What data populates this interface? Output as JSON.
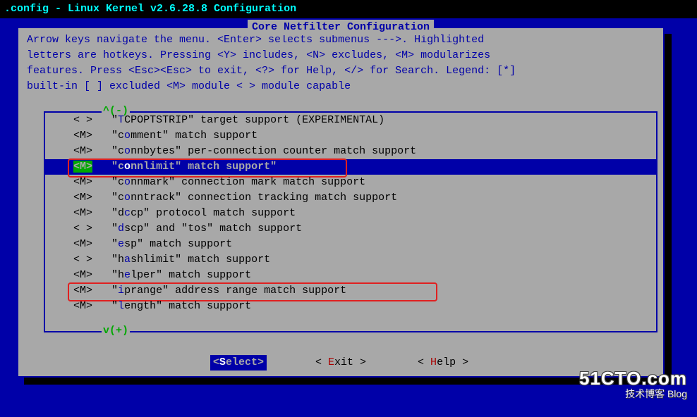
{
  "title_bar": ".config - Linux Kernel v2.6.28.8 Configuration",
  "dialog_title": " Core Netfilter Configuration ",
  "help": {
    "l1": "Arrow keys navigate the menu.  <Enter> selects submenus --->.  Highlighted",
    "l2": "letters are hotkeys.  Pressing <Y> includes, <N> excludes, <M> modularizes",
    "l3": "features.  Press <Esc><Esc> to exit, <?> for Help, </> for Search.  Legend: [*]",
    "l4": "built-in  [ ] excluded  <M> module  < > module capable"
  },
  "scroll_up": "^(-)",
  "scroll_down": "v(+)",
  "items": [
    {
      "sel": "< >",
      "pre": "\"",
      "hot": "T",
      "rest": "CPOPTSTRIP\" target support (EXPERIMENTAL)"
    },
    {
      "sel": "<M>",
      "pre": "\"c",
      "hot": "o",
      "rest": "mment\" match support"
    },
    {
      "sel": "<M>",
      "pre": "\"c",
      "hot": "o",
      "rest": "nnbytes\" per-connection counter match support"
    },
    {
      "sel": "<M>",
      "pre": "\"c",
      "hot": "o",
      "rest": "nnlimit\" match support\""
    },
    {
      "sel": "<M>",
      "pre": "\"c",
      "hot": "o",
      "rest": "nnmark\" connection mark match support"
    },
    {
      "sel": "<M>",
      "pre": "\"c",
      "hot": "o",
      "rest": "nntrack\" connection tracking match support"
    },
    {
      "sel": "<M>",
      "pre": "\"d",
      "hot": "c",
      "rest": "cp\" protocol match support"
    },
    {
      "sel": "< >",
      "pre": "\"",
      "hot": "d",
      "rest": "scp\" and \"tos\" match support"
    },
    {
      "sel": "<M>",
      "pre": "\"",
      "hot": "e",
      "rest": "sp\" match support"
    },
    {
      "sel": "< >",
      "pre": "\"h",
      "hot": "a",
      "rest": "shlimit\" match support"
    },
    {
      "sel": "<M>",
      "pre": "\"h",
      "hot": "e",
      "rest": "lper\" match support"
    },
    {
      "sel": "<M>",
      "pre": "\"",
      "hot": "i",
      "rest": "prange\" address range match support"
    },
    {
      "sel": "<M>",
      "pre": "\"",
      "hot": "l",
      "rest": "ength\" match support"
    }
  ],
  "buttons": {
    "select": {
      "open": "<",
      "hl": "S",
      "rest": "elect>",
      "close": ""
    },
    "exit": {
      "open": "< ",
      "hl": "E",
      "rest": "xit >",
      "close": ""
    },
    "help": {
      "open": "< ",
      "hl": "H",
      "rest": "elp >",
      "close": ""
    }
  },
  "watermark": {
    "big": "51CTO.com",
    "small": "技术博客    Blog"
  }
}
